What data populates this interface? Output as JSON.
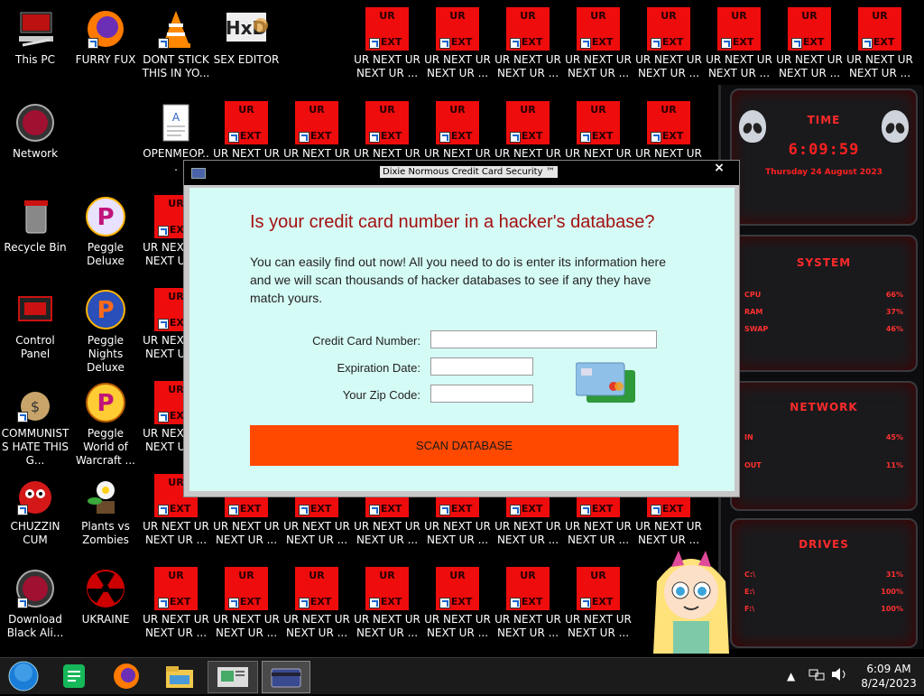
{
  "desktop": {
    "icons": [
      {
        "label": "This PC"
      },
      {
        "label": "FURRY FUX"
      },
      {
        "label": "DONT STICK THIS IN YO..."
      },
      {
        "label": "SEX EDITOR"
      },
      {
        "label": "Network"
      },
      {
        "label": "OPENMEOP..."
      },
      {
        "label": "Recycle Bin"
      },
      {
        "label": "Peggle Deluxe"
      },
      {
        "label": "Control Panel"
      },
      {
        "label": "Peggle Nights Deluxe"
      },
      {
        "label": "COMMUNISTS HATE THIS G..."
      },
      {
        "label": "Peggle World of Warcraft ..."
      },
      {
        "label": "CHUZZIN CUM"
      },
      {
        "label": "Plants vs Zombies"
      },
      {
        "label": "Download Black Ali..."
      },
      {
        "label": "UKRAINE"
      }
    ],
    "ur_icon": {
      "top_text": "UR",
      "bottom_text": "NEXT",
      "label": "UR NEXT UR NEXT UR ..."
    }
  },
  "gadget": {
    "time_title": "TIME",
    "time": "6:09:59",
    "date": "Thursday 24 August 2023",
    "system_title": "SYSTEM",
    "cpu_label": "CPU",
    "cpu_value": "66%",
    "ram_label": "RAM",
    "ram_value": "37%",
    "swap_label": "SWAP",
    "swap_value": "46%",
    "network_title": "NETWORK",
    "in_label": "IN",
    "in_value": "45%",
    "out_label": "OUT",
    "out_value": "11%",
    "drives_title": "DRIVES",
    "drives": [
      {
        "label": "C:\\",
        "value": "31%"
      },
      {
        "label": "E:\\",
        "value": "100%"
      },
      {
        "label": "F:\\",
        "value": "100%"
      }
    ]
  },
  "dialog": {
    "title": "Dixie Normous Credit Card Security ™",
    "close": "×",
    "heading": "Is your credit card number in a hacker's database?",
    "intro": "You can easily find out now! All you need to do is enter its information here and we will scan thousands of hacker databases to see if any they have match yours.",
    "card_label": "Credit Card Number:",
    "card_value": "",
    "exp_label": "Expiration Date:",
    "exp_value": "",
    "zip_label": "Your Zip Code:",
    "zip_value": "",
    "scan_button": "SCAN DATABASE"
  },
  "taskbar": {
    "time": "6:09 AM",
    "date": "8/24/2023"
  }
}
